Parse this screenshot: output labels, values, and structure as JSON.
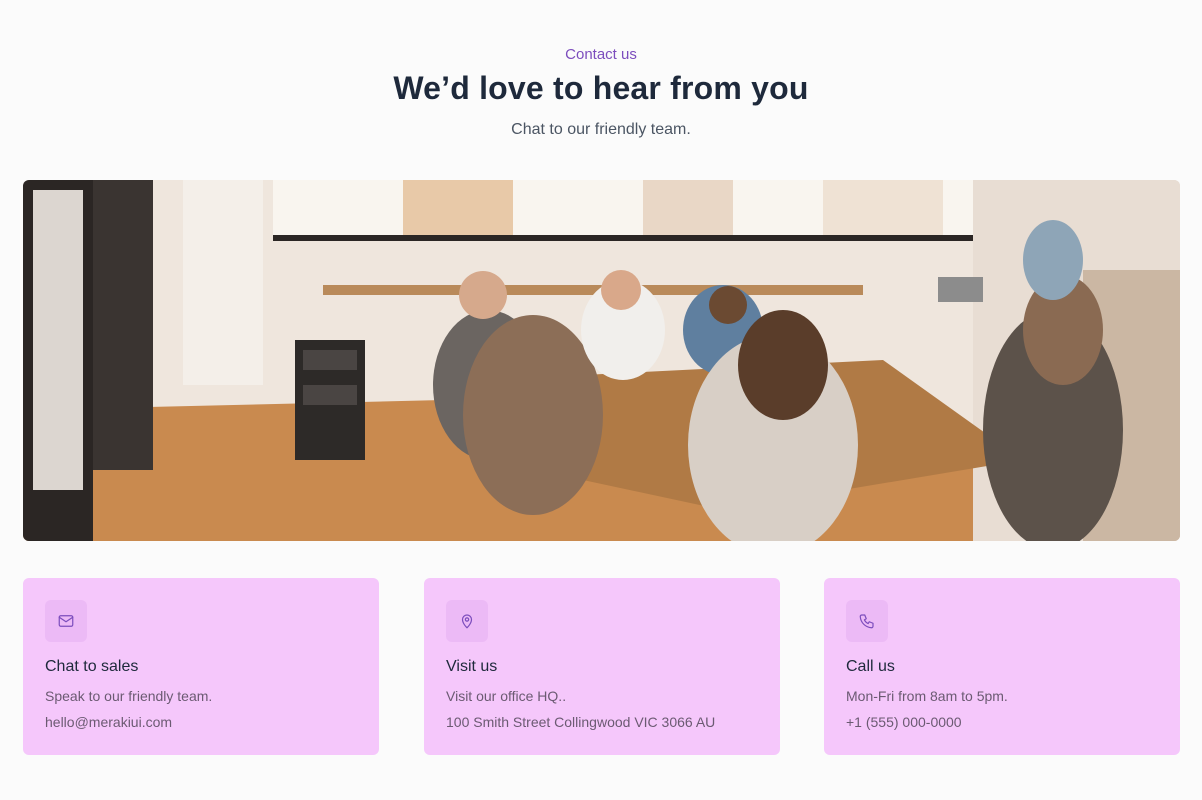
{
  "header": {
    "eyebrow": "Contact us",
    "title": "We’d love to hear from you",
    "subtitle": "Chat to our friendly team."
  },
  "hero_image": {
    "alt": "people-around-table-photo"
  },
  "cards": [
    {
      "icon": "mail-icon",
      "title": "Chat to sales",
      "line1": "Speak to our friendly team.",
      "line2": "hello@merakiui.com"
    },
    {
      "icon": "map-pin-icon",
      "title": "Visit us",
      "line1": "Visit our office HQ..",
      "line2": "100 Smith Street Collingwood VIC 3066 AU"
    },
    {
      "icon": "phone-icon",
      "title": "Call us",
      "line1": "Mon-Fri from 8am to 5pm.",
      "line2": "+1 (555) 000-0000"
    }
  ],
  "colors": {
    "accent": "#7c4dbd",
    "card_bg": "#f5c7fb",
    "icon_bg": "#ecbaf6"
  }
}
